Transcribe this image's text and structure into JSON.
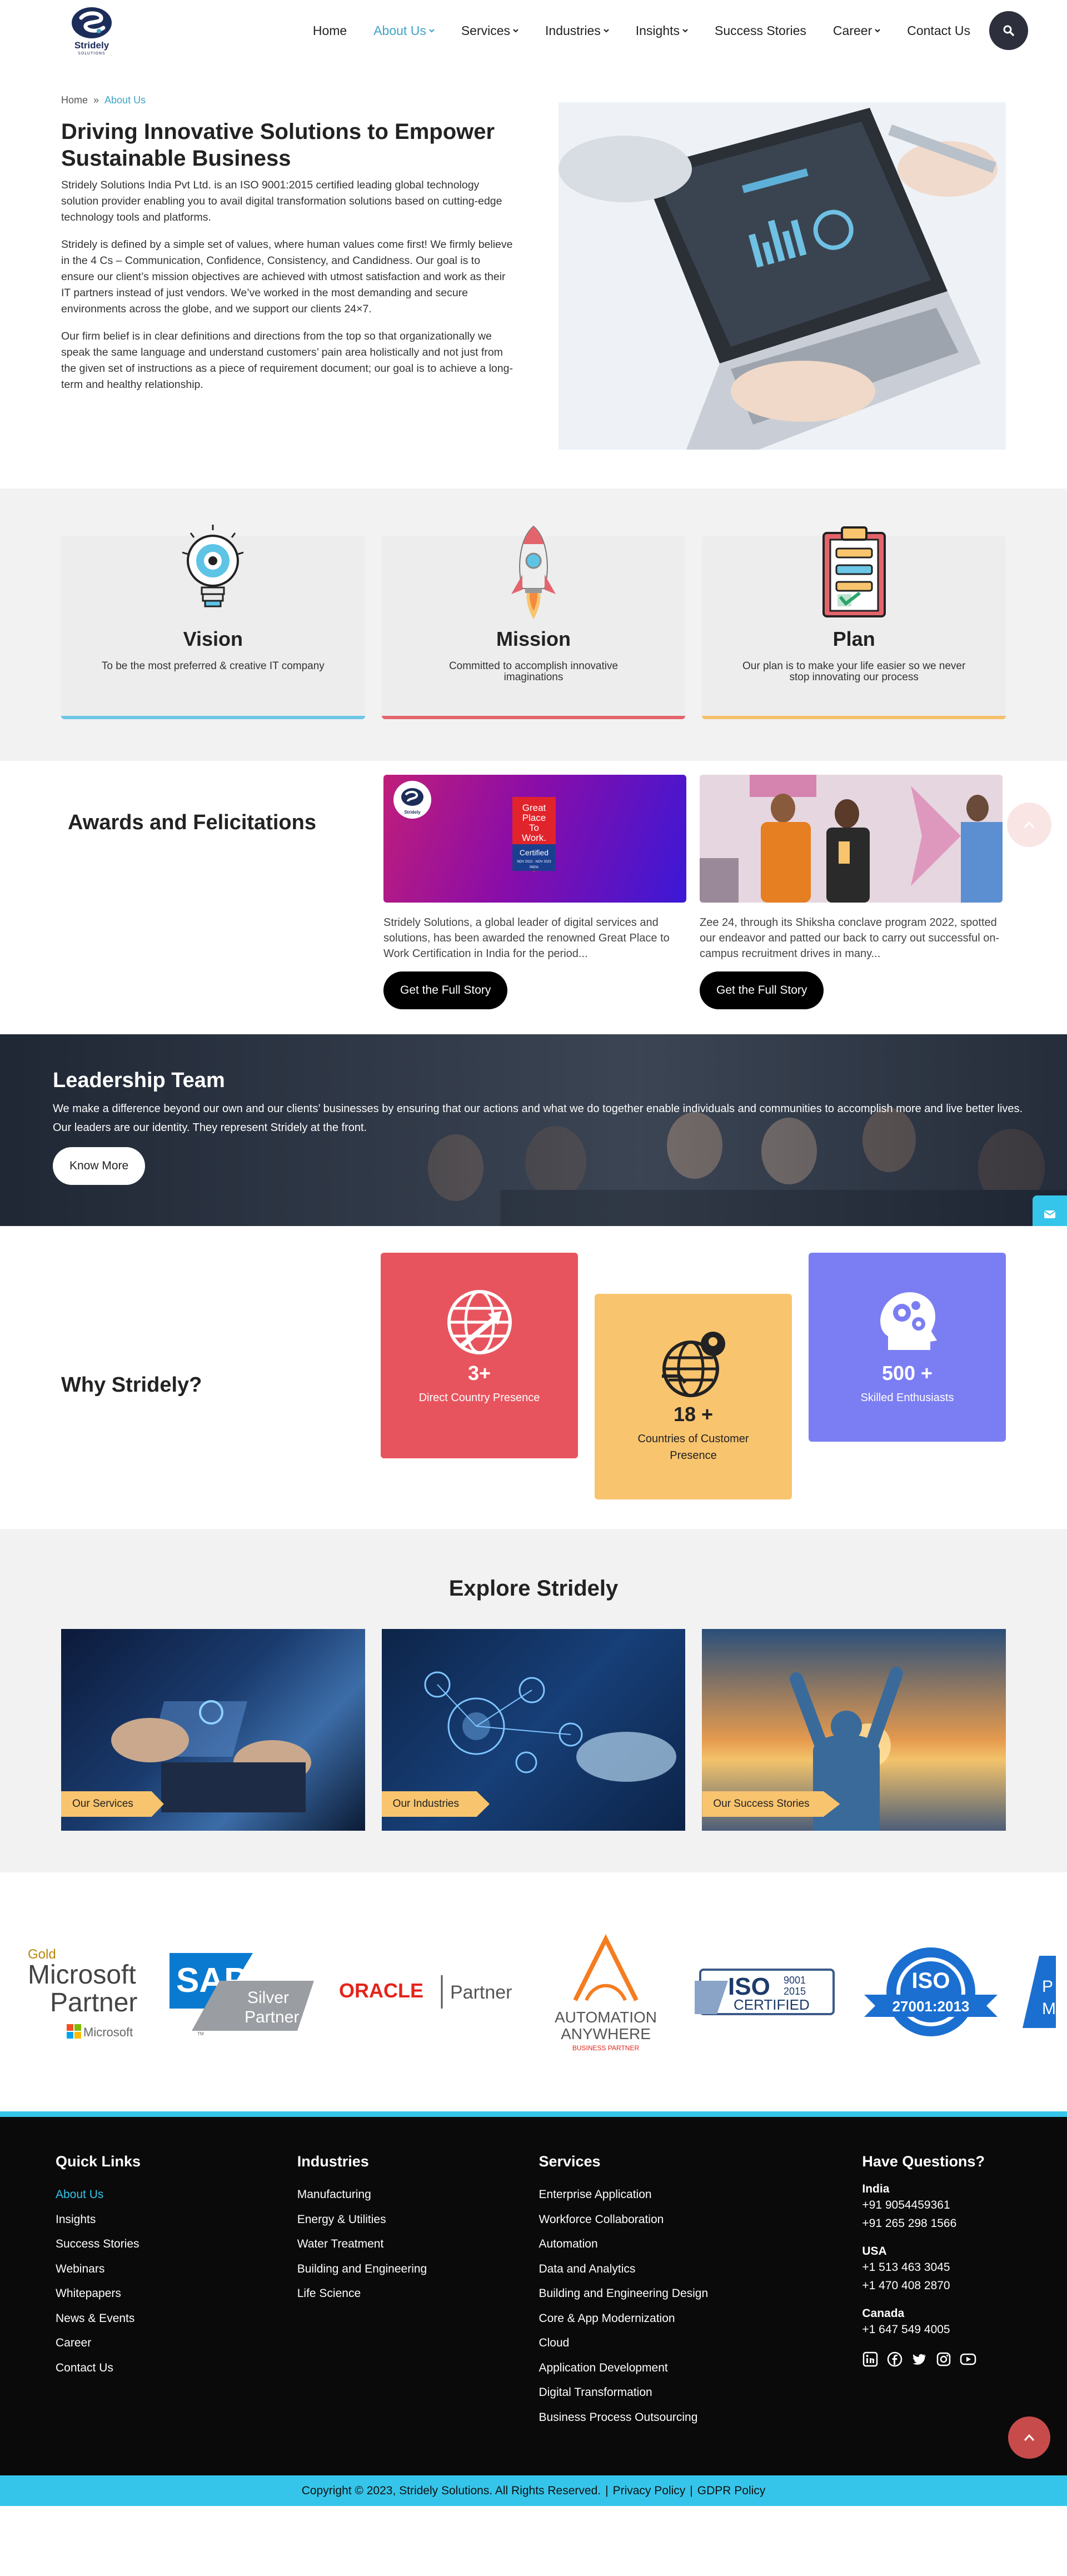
{
  "brand": {
    "name": "Stridely",
    "tagline": "SOLUTIONS"
  },
  "nav": {
    "items": [
      {
        "label": "Home",
        "dropdown": false,
        "active": false
      },
      {
        "label": "About Us",
        "dropdown": true,
        "active": true
      },
      {
        "label": "Services",
        "dropdown": true,
        "active": false
      },
      {
        "label": "Industries",
        "dropdown": true,
        "active": false
      },
      {
        "label": "Insights",
        "dropdown": true,
        "active": false
      },
      {
        "label": "Success Stories",
        "dropdown": false,
        "active": false
      },
      {
        "label": "Career",
        "dropdown": true,
        "active": false
      },
      {
        "label": "Contact Us",
        "dropdown": false,
        "active": false
      }
    ]
  },
  "breadcrumb": {
    "home": "Home",
    "separator": "»",
    "current": "About Us"
  },
  "about": {
    "title": "Driving Innovative Solutions to Empower Sustainable Business",
    "p1": "Stridely Solutions India Pvt Ltd. is an ISO 9001:2015 certified leading global technology solution provider enabling you to avail digital transformation solutions based on cutting-edge technology tools and platforms.",
    "p2": "Stridely is defined by a simple set of values, where human values come first! We firmly believe in the 4 Cs – Communication, Confidence, Consistency, and Candidness. Our goal is to ensure our client’s mission objectives are achieved with utmost satisfaction and work as their IT partners instead of just vendors. We’ve worked in the most demanding and secure environments across the globe, and we support our clients 24×7.",
    "p3": "Our firm belief is in clear definitions and directions from the top so that organizationally we speak the same language and understand customers’ pain area holistically and not just from the given set of instructions as a piece of requirement document; our goal is to achieve a long-term and healthy relationship."
  },
  "vmp": [
    {
      "title": "Vision",
      "text": "To be the most preferred & creative IT company",
      "icon": "lightbulb-icon"
    },
    {
      "title": "Mission",
      "text": "Committed to accomplish innovative imaginations",
      "icon": "rocket-icon"
    },
    {
      "title": "Plan",
      "text": "Our plan is to make your life easier so we never stop innovating our process",
      "icon": "clipboard-icon"
    }
  ],
  "awards": {
    "title": "Awards and Felicitations",
    "items": [
      {
        "text": "Stridely Solutions, a global leader of digital services and solutions, has been awarded the renowned Great Place to Work Certification in India for the period...",
        "button": "Get the Full Story",
        "badge": {
          "line1": "Great",
          "line2": "Place",
          "line3": "To",
          "line4": "Work.",
          "cert": "Certified",
          "period": "NOV 2022 - NOV 2023",
          "country": "INDIA"
        }
      },
      {
        "text": "Zee 24, through its Shiksha conclave program 2022, spotted our endeavor and patted our back to carry out successful on-campus recruitment drives in many...",
        "button": "Get the Full Story"
      }
    ]
  },
  "leadership": {
    "title": "Leadership Team",
    "text": "We make a difference beyond our own and our clients’ businesses by ensuring that our actions and what we do together enable individuals and communities to accomplish more and live better lives. Our leaders are our identity. They represent Stridely at the front.",
    "button": "Know More"
  },
  "why": {
    "title": "Why Stridely?",
    "cards": [
      {
        "number": "3+",
        "label": "Direct Country Presence",
        "color": "#e8545e"
      },
      {
        "number": "18 +",
        "label": "Countries of Customer Presence",
        "color": "#f8c46e"
      },
      {
        "number": "500 +",
        "label": "Skilled Enthusiasts",
        "color": "#7b7ef2"
      }
    ]
  },
  "explore": {
    "title": "Explore Stridely",
    "cards": [
      {
        "tag": "Our Services"
      },
      {
        "tag": "Our Industries"
      },
      {
        "tag": "Our Success Stories"
      }
    ]
  },
  "partners": {
    "microsoft": {
      "gold": "Gold",
      "line1": "Microsoft",
      "line2": "Partner",
      "sub": "Microsoft"
    },
    "sap": {
      "name": "SAP",
      "line1": "Silver",
      "line2": "Partner",
      "tm": "TM"
    },
    "oracle": {
      "name": "ORACLE",
      "suffix": "Partner"
    },
    "automation": {
      "line1": "AUTOMATION",
      "line2": "ANYWHERE",
      "line3": "BUSINESS PARTNER"
    },
    "iso9001": {
      "name": "ISO",
      "code": "9001",
      "year": "2015",
      "label": "CERTIFIED"
    },
    "iso27001": {
      "name": "ISO",
      "code": "27001:2013"
    },
    "partial": {
      "letter": "P",
      "letter2": "M"
    }
  },
  "footer": {
    "quick_links": {
      "title": "Quick Links",
      "items": [
        "About Us",
        "Insights",
        "Success Stories",
        "Webinars",
        "Whitepapers",
        "News & Events",
        "Career",
        "Contact Us"
      ]
    },
    "industries": {
      "title": "Industries",
      "items": [
        "Manufacturing",
        "Energy & Utilities",
        "Water Treatment",
        "Building and Engineering",
        "Life Science"
      ]
    },
    "services": {
      "title": "Services",
      "items": [
        "Enterprise Application",
        "Workforce Collaboration",
        "Automation",
        "Data and Analytics",
        "Building and Engineering Design",
        "Core & App Modernization",
        "Cloud",
        "Application Development",
        "Digital Transformation",
        "Business Process Outsourcing"
      ]
    },
    "questions": {
      "title": "Have Questions?",
      "india": {
        "country": "India",
        "phones": [
          "+91 9054459361",
          "+91 265 298 1566"
        ]
      },
      "usa": {
        "country": "USA",
        "phones": [
          "+1 513 463 3045",
          "+1 470 408 2870"
        ]
      },
      "canada": {
        "country": "Canada",
        "phones": [
          "+1 647 549 4005"
        ]
      }
    },
    "social": [
      "linkedin-icon",
      "facebook-icon",
      "twitter-icon",
      "instagram-icon",
      "youtube-icon"
    ]
  },
  "copyright": {
    "text": "Copyright © 2023, Stridely Solutions. All Rights Reserved.",
    "sep1": "|",
    "privacy": "Privacy Policy",
    "sep2": "|",
    "gdpr": "GDPR Policy"
  },
  "colors": {
    "accent": "#3fa3c6",
    "footer_accent": "#36c5ea",
    "vision": "#6cc6e6",
    "mission": "#e4646c",
    "plan": "#f6bf6b"
  }
}
